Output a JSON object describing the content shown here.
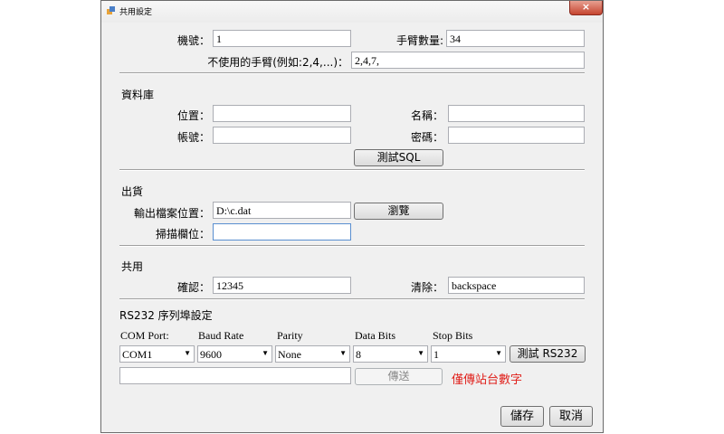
{
  "window": {
    "title": "共用設定",
    "close_label": "×"
  },
  "basic": {
    "machine_label": "機號：",
    "machine_value": "1",
    "arm_count_label": "手臂數量:",
    "arm_count_value": "34",
    "unused_arms_label": "不使用的手臂(例如:2,4,...)：",
    "unused_arms_value": "2,4,7,"
  },
  "database": {
    "section_title": "資料庫",
    "location_label": "位置：",
    "location_value": "",
    "name_label": "名稱：",
    "name_value": "",
    "account_label": "帳號：",
    "account_value": "",
    "password_label": "密碼：",
    "password_value": "",
    "test_sql_button": "測試SQL"
  },
  "shipping": {
    "section_title": "出貨",
    "output_path_label": "輸出檔案位置：",
    "output_path_value": "D:\\c.dat",
    "browse_button": "瀏覽",
    "scan_field_label": "掃描欄位：",
    "scan_field_value": ""
  },
  "common": {
    "section_title": "共用",
    "confirm_label": "確認：",
    "confirm_value": "12345",
    "clear_label": "清除：",
    "clear_value": "backspace"
  },
  "rs232": {
    "section_title": "RS232 序列埠設定",
    "com_port_label": "COM Port:",
    "com_port_value": "COM1",
    "baud_rate_label": "Baud Rate",
    "baud_rate_value": "9600",
    "parity_label": "Parity",
    "parity_value": "None",
    "data_bits_label": "Data Bits",
    "data_bits_value": "8",
    "stop_bits_label": "Stop Bits",
    "stop_bits_value": "1",
    "test_button": "測試 RS232",
    "send_input_value": "",
    "send_button": "傳送",
    "hint": "僅傳站台數字"
  },
  "footer": {
    "save_button": "儲存",
    "cancel_button": "取消"
  },
  "colors": {
    "hint": "#e0201b",
    "window_bg": "#f0f0f0"
  }
}
